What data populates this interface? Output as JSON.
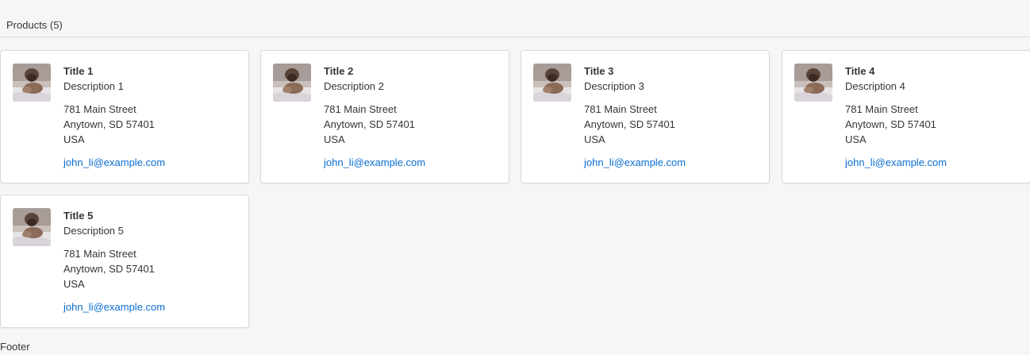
{
  "header": {
    "title": "Products (5)"
  },
  "cards": [
    {
      "title": "Title 1",
      "description": "Description 1",
      "street": "781 Main Street",
      "city": "Anytown, SD 57401",
      "country": "USA",
      "email": "john_li@example.com"
    },
    {
      "title": "Title 2",
      "description": "Description 2",
      "street": "781 Main Street",
      "city": "Anytown, SD 57401",
      "country": "USA",
      "email": "john_li@example.com"
    },
    {
      "title": "Title 3",
      "description": "Description 3",
      "street": "781 Main Street",
      "city": "Anytown, SD 57401",
      "country": "USA",
      "email": "john_li@example.com"
    },
    {
      "title": "Title 4",
      "description": "Description 4",
      "street": "781 Main Street",
      "city": "Anytown, SD 57401",
      "country": "USA",
      "email": "john_li@example.com"
    },
    {
      "title": "Title 5",
      "description": "Description 5",
      "street": "781 Main Street",
      "city": "Anytown, SD 57401",
      "country": "USA",
      "email": "john_li@example.com"
    }
  ],
  "footer": {
    "label": "Footer"
  },
  "colors": {
    "link": "#0a6ed1",
    "text": "#32363a",
    "background": "#f6f6f6",
    "card": "#ffffff"
  },
  "icons": {
    "avatar": "dog-photo-avatar"
  }
}
